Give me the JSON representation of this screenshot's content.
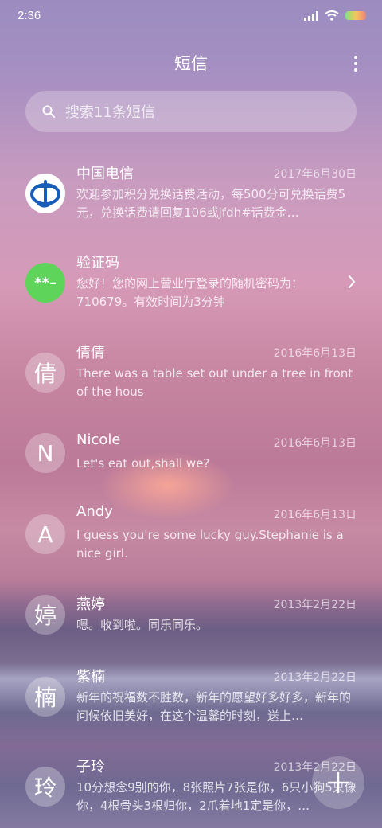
{
  "status": {
    "time": "2:36"
  },
  "header": {
    "title": "短信"
  },
  "search": {
    "placeholder": "搜索11条短信"
  },
  "conversations": [
    {
      "name": "中国电信",
      "date": "2017年6月30日",
      "snippet": "欢迎参加积分兑换话费活动，每500分可兑换话费5元，兑换话费请回复106或jfdh#话费金…",
      "avatar": "telecom-logo",
      "show_date": true
    },
    {
      "name": "验证码",
      "date": "",
      "snippet": "您好！您的网上营业厅登录的随机密码为：710679。有效时间为3分钟",
      "avatar_text": "**–",
      "show_chevron": true
    },
    {
      "name": "倩倩",
      "date": "2016年6月13日",
      "snippet": "There was a table set out under a tree in front of the hous",
      "avatar_text": "倩"
    },
    {
      "name": "Nicole",
      "date": "2016年6月13日",
      "snippet": "Let's eat out,shall we?",
      "avatar_text": "N"
    },
    {
      "name": "Andy",
      "date": "2016年6月13日",
      "snippet": "I guess you're some lucky guy.Stephanie is a nice girl.",
      "avatar_text": "A"
    },
    {
      "name": "燕婷",
      "date": "2013年2月22日",
      "snippet": "嗯。收到啦。同乐同乐。",
      "avatar_text": "婷"
    },
    {
      "name": "紫楠",
      "date": "2013年2月22日",
      "snippet": "新年的祝福数不胜数，新年的愿望好多好多，新年的问候依旧美好，在这个温馨的时刻，送上…",
      "avatar_text": "楠"
    },
    {
      "name": "子玲",
      "date": "2013年2月22日",
      "snippet": "10分想念9别的你，8张照片7张是你，6只小狗5只像你，4根骨头3根归你，2爪着地1定是你，…",
      "avatar_text": "玲"
    }
  ],
  "fab": {
    "icon": "plus-icon"
  }
}
